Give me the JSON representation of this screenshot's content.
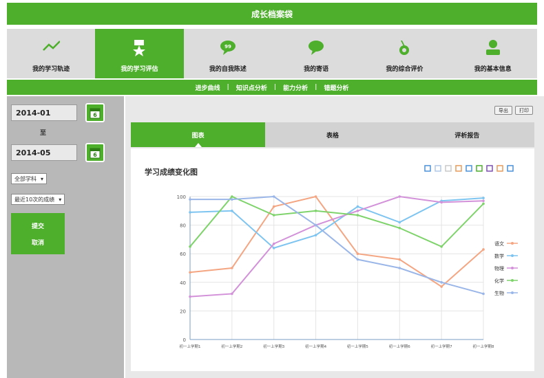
{
  "header": {
    "title": "成长档案袋"
  },
  "nav": {
    "items": [
      {
        "label": "我的学习轨迹",
        "icon": "trend-line-icon",
        "active": false
      },
      {
        "label": "我的学习评估",
        "icon": "award-badge-icon",
        "active": true
      },
      {
        "label": "我的自我陈述",
        "icon": "speech-bubble-icon",
        "active": false
      },
      {
        "label": "我的寄语",
        "icon": "chat-bubble-icon",
        "active": false
      },
      {
        "label": "我的综合评价",
        "icon": "medal-icon",
        "active": false
      },
      {
        "label": "我的基本信息",
        "icon": "user-icon",
        "active": false
      }
    ]
  },
  "subnav": {
    "items": [
      "进步曲线",
      "知识点分析",
      "能力分析",
      "错题分析"
    ]
  },
  "sidebar": {
    "start_date": "2014-01",
    "to_label": "至",
    "end_date": "2014-05",
    "calendar_icon_text": "6",
    "subject_select": "全部学科",
    "count_select": "最近10次的成绩",
    "submit_label": "提交",
    "cancel_label": "取消"
  },
  "main": {
    "top_buttons": [
      "导出",
      "打印"
    ],
    "tabs": [
      {
        "label": "图表",
        "active": true
      },
      {
        "label": "表格",
        "active": false
      },
      {
        "label": "评析报告",
        "active": false
      }
    ],
    "chart_title": "学习成绩变化图",
    "toolbox_icons": [
      "mark-icon",
      "erase-icon",
      "zoom-icon",
      "data-view-icon",
      "line-chart-icon",
      "bar-chart-icon",
      "stack-icon",
      "tiled-icon",
      "refresh-icon"
    ]
  },
  "chart_data": {
    "type": "line",
    "title": "学习成绩变化图",
    "categories": [
      "初一上学期1",
      "初一上学期2",
      "初一上学期3",
      "初一上学期4",
      "初一上学期5",
      "初一上学期6",
      "初一上学期7",
      "初一上学期8"
    ],
    "ylim": [
      0,
      100
    ],
    "yticks": [
      0,
      20,
      40,
      60,
      80,
      100
    ],
    "grid": true,
    "legend_position": "right",
    "series": [
      {
        "name": "语文",
        "color": "#f4a582",
        "values": [
          47,
          50,
          93,
          100,
          60,
          56,
          37,
          63
        ]
      },
      {
        "name": "数学",
        "color": "#7ec4f0",
        "values": [
          89,
          90,
          64,
          73,
          93,
          82,
          97,
          99
        ]
      },
      {
        "name": "物理",
        "color": "#d291d9",
        "values": [
          30,
          32,
          67,
          80,
          90,
          100,
          96,
          97
        ]
      },
      {
        "name": "化学",
        "color": "#7ed36a",
        "values": [
          65,
          100,
          87,
          90,
          87,
          78,
          65,
          95
        ]
      },
      {
        "name": "生物",
        "color": "#9ab6e8",
        "values": [
          98,
          98,
          100,
          80,
          56,
          50,
          40,
          32
        ]
      }
    ]
  }
}
